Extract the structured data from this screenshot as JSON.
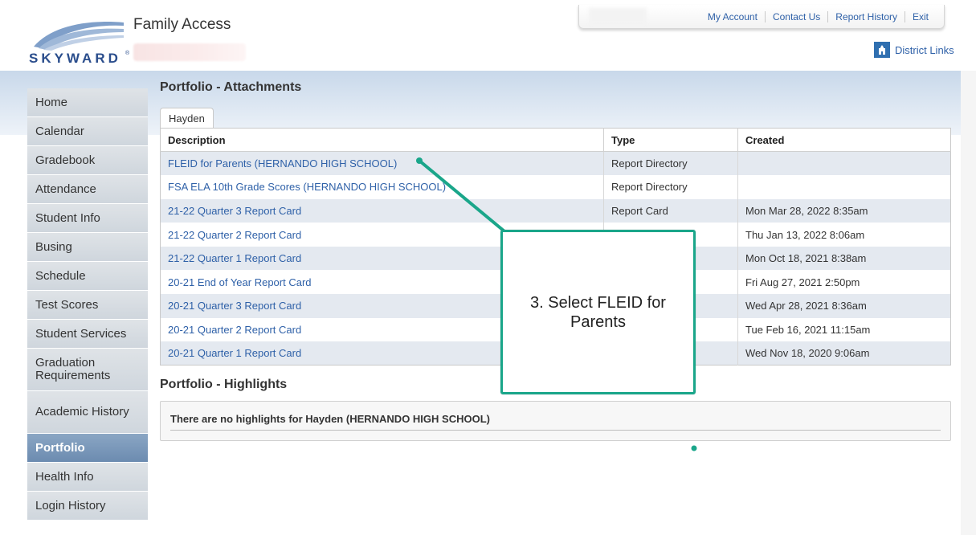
{
  "header": {
    "app_title": "Family Access",
    "logo_text": "SKYWARD",
    "logo_mark": "®",
    "top_links": [
      "My Account",
      "Contact Us",
      "Report History",
      "Exit"
    ],
    "district_links": "District Links"
  },
  "sidebar": {
    "items": [
      {
        "label": "Home"
      },
      {
        "label": "Calendar"
      },
      {
        "label": "Gradebook"
      },
      {
        "label": "Attendance"
      },
      {
        "label": "Student Info"
      },
      {
        "label": "Busing"
      },
      {
        "label": "Schedule"
      },
      {
        "label": "Test Scores"
      },
      {
        "label": "Student Services"
      },
      {
        "label": "Graduation Requirements"
      },
      {
        "label": "Academic History"
      },
      {
        "label": "Portfolio"
      },
      {
        "label": "Health Info"
      },
      {
        "label": "Login History"
      }
    ],
    "active": "Portfolio"
  },
  "main": {
    "attachments_title": "Portfolio - Attachments",
    "student_tab": "Hayden",
    "columns": [
      "Description",
      "Type",
      "Created"
    ],
    "rows": [
      {
        "description": "FLEID for Parents (HERNANDO HIGH SCHOOL)",
        "type": "Report Directory",
        "created": ""
      },
      {
        "description": "FSA ELA 10th Grade Scores (HERNANDO HIGH SCHOOL)",
        "type": "Report Directory",
        "created": ""
      },
      {
        "description": "21-22 Quarter 3 Report Card",
        "type": "Report Card",
        "created": "Mon Mar 28, 2022 8:35am"
      },
      {
        "description": "21-22 Quarter 2 Report Card",
        "type": "",
        "created": "Thu Jan 13, 2022 8:06am"
      },
      {
        "description": "21-22 Quarter 1 Report Card",
        "type": "",
        "created": "Mon Oct 18, 2021 8:38am"
      },
      {
        "description": "20-21 End of Year Report Card",
        "type": "",
        "created": "Fri Aug 27, 2021 2:50pm"
      },
      {
        "description": "20-21 Quarter 3 Report Card",
        "type": "",
        "created": "Wed Apr 28, 2021 8:36am"
      },
      {
        "description": "20-21 Quarter 2 Report Card",
        "type": "",
        "created": "Tue Feb 16, 2021 11:15am"
      },
      {
        "description": "20-21 Quarter 1 Report Card",
        "type": "",
        "created": "Wed Nov 18, 2020 9:06am"
      }
    ],
    "highlights_title": "Portfolio - Highlights",
    "highlights_message": "There are no highlights for Hayden (HERNANDO HIGH SCHOOL)"
  },
  "annotation": {
    "text": "3. Select FLEID for Parents",
    "color": "#1aa68a"
  },
  "colors": {
    "link": "#2f61a8",
    "active_nav": "#6c8bb0",
    "row_alt": "#e4e9f0"
  }
}
